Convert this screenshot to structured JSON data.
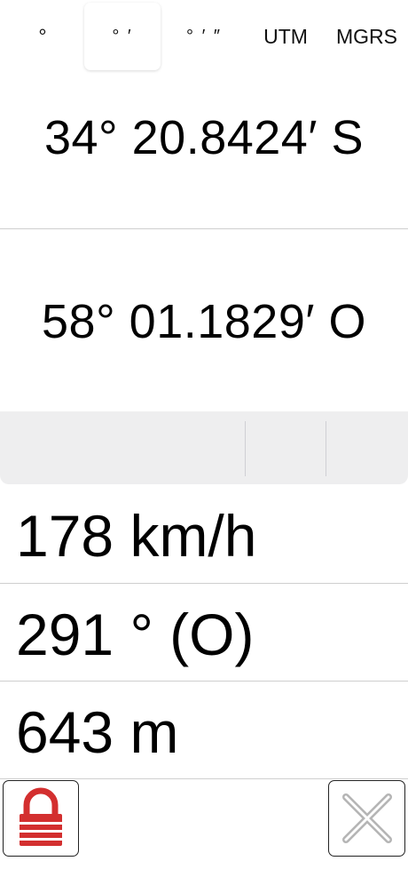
{
  "coordinates": {
    "latitude": "34° 20.8424′ S",
    "longitude": "58° 01.1829′ O"
  },
  "format_selector": {
    "options": [
      "°",
      "° ′",
      "° ′ ″",
      "UTM",
      "MGRS"
    ],
    "selected": "° ′"
  },
  "stats": {
    "speed": "178 km/h",
    "heading": "291 ° (O)",
    "altitude": "643 m"
  },
  "buttons": {
    "lock_icon": "lock-icon",
    "close_icon": "close-icon"
  },
  "colors": {
    "lock_red": "#d32f2f",
    "close_gray": "#b5b5b5",
    "selector_bg": "#eeeeef"
  }
}
